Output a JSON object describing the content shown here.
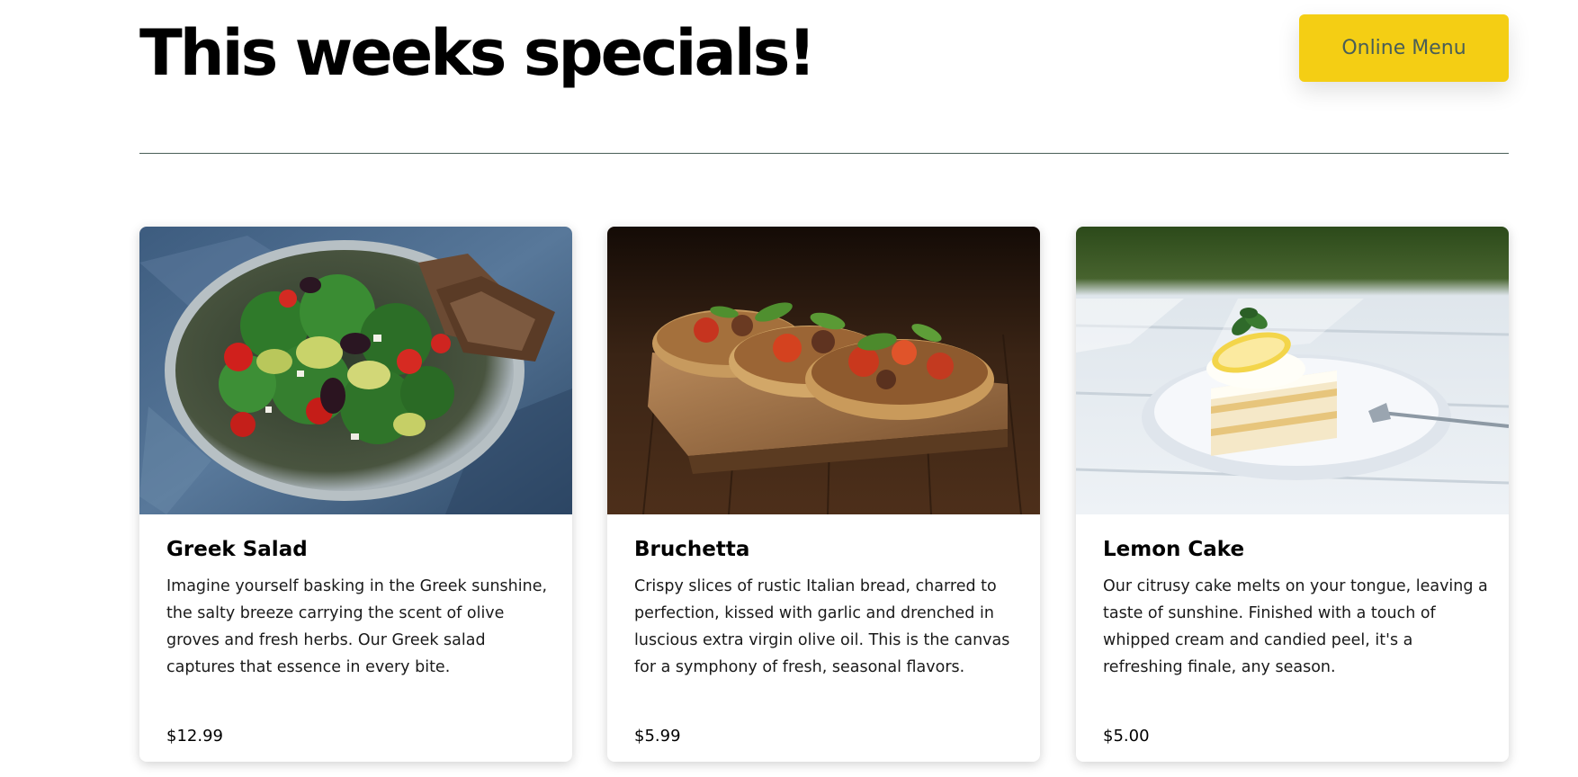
{
  "header": {
    "title": "This weeks specials!",
    "button_label": "Online Menu"
  },
  "specials": [
    {
      "name": "Greek Salad",
      "description": "Imagine yourself basking in the Greek sunshine, the salty breeze carrying the scent of olive groves and fresh herbs. Our Greek salad captures that essence in every bite.",
      "price": "$12.99",
      "image": "greek-salad-photo"
    },
    {
      "name": "Bruchetta",
      "description": "Crispy slices of rustic Italian bread, charred to perfection, kissed with garlic and drenched in luscious extra virgin olive oil. This is the canvas for a symphony of fresh, seasonal flavors.",
      "price": "$5.99",
      "image": "bruschetta-photo"
    },
    {
      "name": "Lemon Cake",
      "description": "Our citrusy cake melts on your tongue, leaving a taste of sunshine. Finished with a touch of whipped cream and candied peel, it's a refreshing finale, any season.",
      "price": "$5.00",
      "image": "lemon-cake-photo"
    }
  ],
  "colors": {
    "accent_yellow": "#f4ce14",
    "button_text": "#495e57",
    "divider": "#495e57"
  }
}
